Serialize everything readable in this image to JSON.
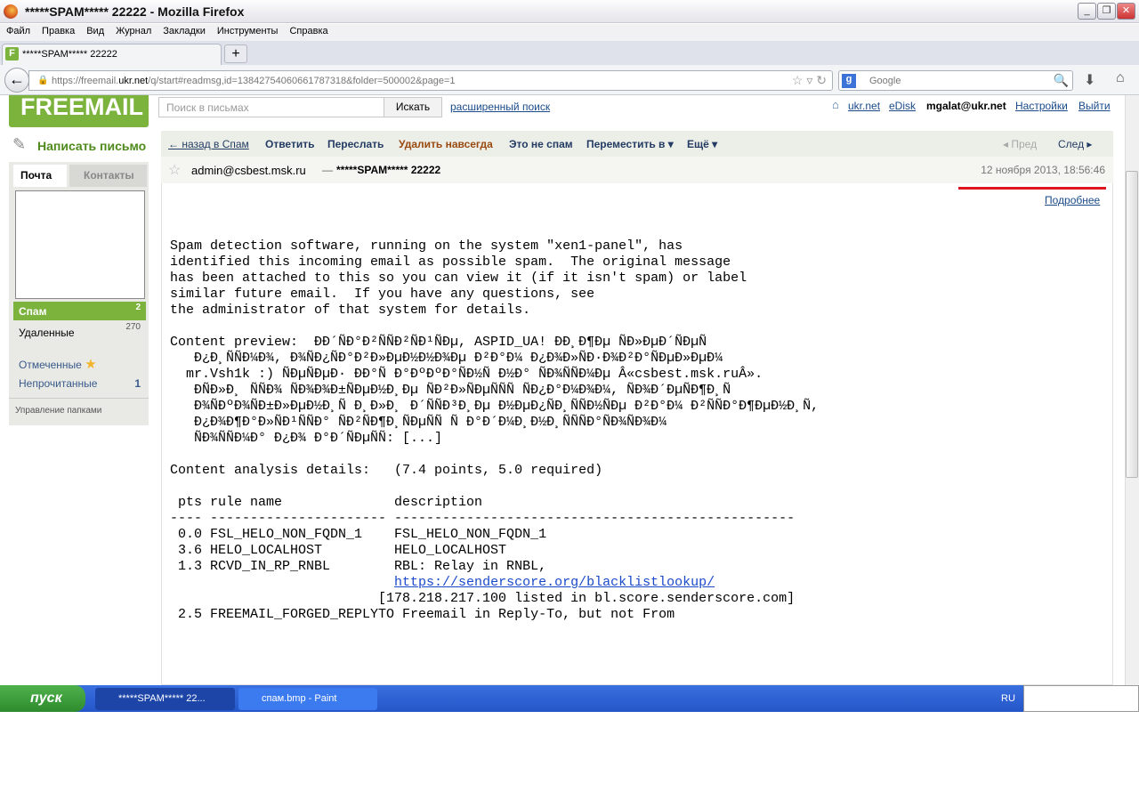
{
  "window": {
    "title": "*****SPAM***** 22222 - Mozilla Firefox"
  },
  "menu": [
    "Файл",
    "Правка",
    "Вид",
    "Журнал",
    "Закладки",
    "Инструменты",
    "Справка"
  ],
  "tab": {
    "label": "*****SPAM***** 22222",
    "favicon": "F",
    "new": "+"
  },
  "address": {
    "prefix": "https://freemail.",
    "host": "ukr.net",
    "path": "/q/start#readmsg,id=13842754060661787318&folder=500002&page=1"
  },
  "websearch": {
    "placeholder": "Google",
    "engine": "g"
  },
  "site": {
    "logo": "FREEMAIL",
    "search_placeholder": "Поиск в письмах",
    "search_btn": "Искать",
    "advanced": "расширенный поиск",
    "top_links": [
      "ukr.net",
      "eDisk"
    ],
    "user": "mgalat@ukr.net",
    "settings": "Настройки",
    "logout": "Выйти"
  },
  "sidebar": {
    "compose": "Написать письмо",
    "tab_mail": "Почта",
    "tab_contacts": "Контакты",
    "spam": "Спам",
    "spam_count": "2",
    "deleted": "Удаленные",
    "deleted_count": "270",
    "flagged": "Отмеченные",
    "unread": "Непрочитанные",
    "unread_count": "1",
    "manage": "Управление папками"
  },
  "toolbar": {
    "back": "← назад в Спам",
    "reply": "Ответить",
    "forward": "Переслать",
    "delete": "Удалить навсегда",
    "notspam": "Это не спам",
    "move": "Переместить в ▾",
    "more": "Ещё ▾",
    "prev": "◂ Пред",
    "next": "След ▸"
  },
  "message": {
    "from": "admin@csbest.msk.ru",
    "dash": "—",
    "subject": "*****SPAM***** 22222",
    "date": "12 ноября 2013, 18:56:46",
    "details": "Подробнее",
    "body_a": "Spam detection software, running on the system \"xen1-panel\", has\nidentified this incoming email as possible spam.  The original message\nhas been attached to this so you can view it (if it isn't spam) or label\nsimilar future email.  If you have any questions, see\nthe administrator of that system for details.\n\nContent preview:  ÐÐ´ÑÐ°Ð²ÑÑÐ²ÑÐ¹ÑÐµ, ASPID_UA! ÐÐ¸Ð¶Ðµ ÑÐ»ÐµÐ´ÑÐµÑ\n   Ð¿Ð¸ÑÑÐ¼Ð¾, Ð¾ÑÐ¿ÑÐ°Ð²Ð»ÐµÐ½Ð½Ð¾Ðµ Ð²Ð°Ð¼ Ð¿Ð¾Ð»ÑÐ·Ð¾Ð²Ð°ÑÐµÐ»ÐµÐ¼\n  mr.Vsh1k :) ÑÐµÑÐµÐ· ÐÐ°Ñ Ð°ÐºÐºÐ°ÑÐ½Ñ Ð½Ð° ÑÐ¾ÑÑÐ¼Ðµ Â«csbest.msk.ruÂ».\n   ÐÑÐ»Ð¸ ÑÑÐ¾ ÑÐ¾Ð¾Ð±ÑÐµÐ½Ð¸Ðµ ÑÐ²Ð»ÑÐµÑÑÑ ÑÐ¿Ð°Ð¼Ð¾Ð¼, ÑÐ¾Ð´ÐµÑÐ¶Ð¸Ñ\n   Ð¾ÑÐºÐ¾ÑÐ±Ð»ÐµÐ½Ð¸Ñ Ð¸Ð»Ð¸ Ð´ÑÑÐ³Ð¸Ðµ Ð½ÐµÐ¿ÑÐ¸ÑÑÐ½ÑÐµ Ð²Ð°Ð¼ Ð²ÑÑÐ°Ð¶ÐµÐ½Ð¸Ñ,\n   Ð¿Ð¾Ð¶Ð°Ð»ÑÐ¹ÑÑÐ° ÑÐ²ÑÐ¶Ð¸ÑÐµÑÑ Ñ Ð°Ð´Ð¼Ð¸Ð½Ð¸ÑÑÑÐ°ÑÐ¾ÑÐ¾Ð¼\n   ÑÐ¾ÑÑÐ¼Ð° Ð¿Ð¾ Ð°Ð´ÑÐµÑÑ: [...]\n\nContent analysis details:   (7.4 points, 5.0 required)\n\n pts rule name              description\n---- ---------------------- --------------------------------------------------\n 0.0 FSL_HELO_NON_FQDN_1    FSL_HELO_NON_FQDN_1\n 3.6 HELO_LOCALHOST         HELO_LOCALHOST\n 1.3 RCVD_IN_RP_RNBL        RBL: Relay in RNBL,\n                            ",
    "link": "https://senderscore.org/blacklistlookup/",
    "body_b": "\n                          [178.218.217.100 listed in bl.score.senderscore.com]\n 2.5 FREEMAIL_FORGED_REPLYTO Freemail in Reply-To, but not From"
  },
  "taskbar": {
    "start": "пуск",
    "tasks": [
      "*****SPAM***** 22...",
      "спам.bmp - Paint"
    ],
    "lang": "RU"
  },
  "colors": {
    "brand": "#7bb33d",
    "annotation": "#e0141e"
  }
}
